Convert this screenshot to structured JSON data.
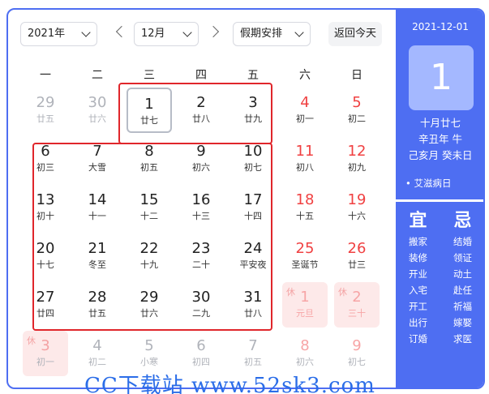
{
  "toolbar": {
    "year": "2021年",
    "month": "12月",
    "holiday": "假期安排",
    "today": "返回今天"
  },
  "weekdays": [
    "一",
    "二",
    "三",
    "四",
    "五",
    "六",
    "日"
  ],
  "days": [
    {
      "d": "29",
      "l": "廿五",
      "kind": "other"
    },
    {
      "d": "30",
      "l": "廿六",
      "kind": "other"
    },
    {
      "d": "1",
      "l": "廿七",
      "kind": "selected"
    },
    {
      "d": "2",
      "l": "廿八",
      "kind": ""
    },
    {
      "d": "3",
      "l": "廿九",
      "kind": ""
    },
    {
      "d": "4",
      "l": "初一",
      "kind": "weekend"
    },
    {
      "d": "5",
      "l": "初二",
      "kind": "weekend"
    },
    {
      "d": "6",
      "l": "初三",
      "kind": ""
    },
    {
      "d": "7",
      "l": "大雪",
      "kind": ""
    },
    {
      "d": "8",
      "l": "初五",
      "kind": ""
    },
    {
      "d": "9",
      "l": "初六",
      "kind": ""
    },
    {
      "d": "10",
      "l": "初七",
      "kind": ""
    },
    {
      "d": "11",
      "l": "初八",
      "kind": "weekend"
    },
    {
      "d": "12",
      "l": "初九",
      "kind": "weekend"
    },
    {
      "d": "13",
      "l": "初十",
      "kind": ""
    },
    {
      "d": "14",
      "l": "十一",
      "kind": ""
    },
    {
      "d": "15",
      "l": "十二",
      "kind": ""
    },
    {
      "d": "16",
      "l": "十三",
      "kind": ""
    },
    {
      "d": "17",
      "l": "十四",
      "kind": ""
    },
    {
      "d": "18",
      "l": "十五",
      "kind": "weekend"
    },
    {
      "d": "19",
      "l": "十六",
      "kind": "weekend"
    },
    {
      "d": "20",
      "l": "十七",
      "kind": ""
    },
    {
      "d": "21",
      "l": "冬至",
      "kind": ""
    },
    {
      "d": "22",
      "l": "十九",
      "kind": ""
    },
    {
      "d": "23",
      "l": "二十",
      "kind": ""
    },
    {
      "d": "24",
      "l": "平安夜",
      "kind": ""
    },
    {
      "d": "25",
      "l": "圣诞节",
      "kind": "weekend"
    },
    {
      "d": "26",
      "l": "廿三",
      "kind": "weekend"
    },
    {
      "d": "27",
      "l": "廿四",
      "kind": ""
    },
    {
      "d": "28",
      "l": "廿五",
      "kind": ""
    },
    {
      "d": "29",
      "l": "廿六",
      "kind": ""
    },
    {
      "d": "30",
      "l": "二九",
      "kind": ""
    },
    {
      "d": "31",
      "l": "廿八",
      "kind": ""
    },
    {
      "d": "1",
      "l": "元旦",
      "kind": "holiday",
      "tag": "休"
    },
    {
      "d": "2",
      "l": "三十",
      "kind": "holiday",
      "tag": "休"
    },
    {
      "d": "3",
      "l": "初一",
      "kind": "holiday-work",
      "tag": "休"
    },
    {
      "d": "4",
      "l": "初二",
      "kind": "other"
    },
    {
      "d": "5",
      "l": "小寒",
      "kind": "other"
    },
    {
      "d": "6",
      "l": "初四",
      "kind": "other"
    },
    {
      "d": "7",
      "l": "初五",
      "kind": "other"
    },
    {
      "d": "8",
      "l": "初六",
      "kind": "other weekend"
    },
    {
      "d": "9",
      "l": "初七",
      "kind": "other weekend"
    }
  ],
  "panel": {
    "date": "2021-12-01",
    "day": "1",
    "lunar1": "十月廿七",
    "lunar2": "辛丑年 牛",
    "lunar3": "己亥月 癸未日",
    "festival": "• 艾滋病日",
    "yi_title": "宜",
    "ji_title": "忌",
    "yi": [
      "搬家",
      "装修",
      "开业",
      "入宅",
      "开工",
      "出行",
      "订婚"
    ],
    "ji": [
      "结婚",
      "领证",
      "动土",
      "赴任",
      "祈福",
      "嫁娶",
      "求医"
    ]
  },
  "watermark": "CC下载站 www.52sk3.com",
  "colors": {
    "accent": "#4e6ef2",
    "highlight": "#e0262b",
    "weekend": "#f04142"
  }
}
